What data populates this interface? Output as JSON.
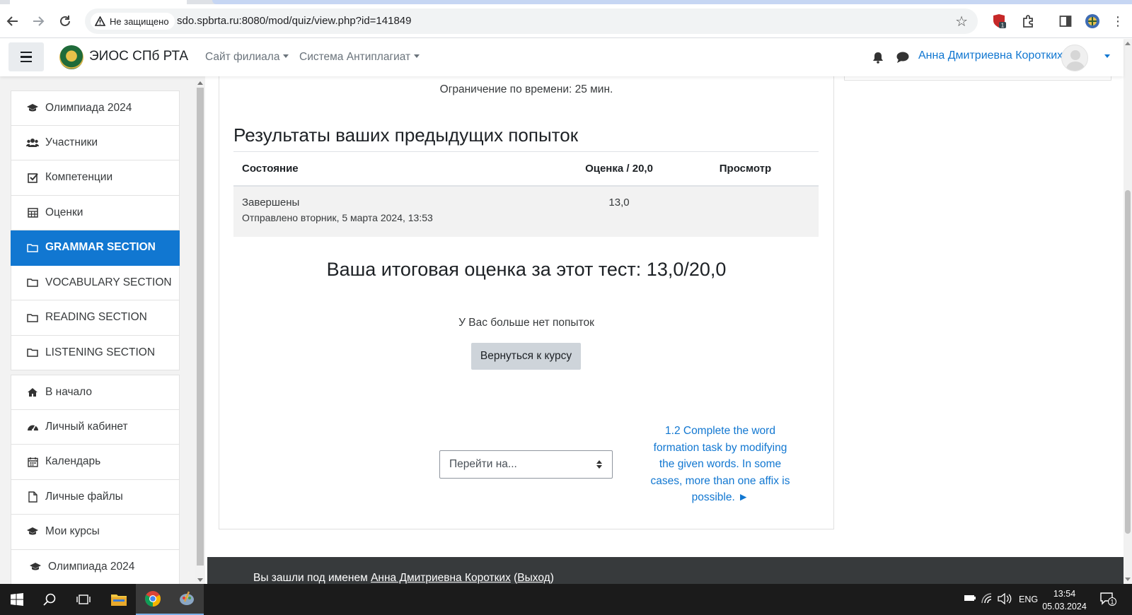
{
  "browser": {
    "security_label": "Не защищено",
    "url": "sdo.spbrta.ru:8080/mod/quiz/view.php?id=141849",
    "extension_badge": "1"
  },
  "navbar": {
    "brand": "ЭИОС СПб РТА",
    "menu": [
      {
        "label": "Сайт филиала"
      },
      {
        "label": "Система Антиплагиат"
      }
    ],
    "user_name": "Анна Дмитриевна Коротких"
  },
  "drawer": {
    "items": [
      {
        "label": "Олимпиада 2024",
        "icon": "graduation-cap-icon"
      },
      {
        "label": "Участники",
        "icon": "users-icon"
      },
      {
        "label": "Компетенции",
        "icon": "check-square-icon"
      },
      {
        "label": "Оценки",
        "icon": "table-icon"
      },
      {
        "label": "GRAMMAR SECTION",
        "icon": "folder-icon",
        "active": true
      },
      {
        "label": "VOCABULARY SECTION",
        "icon": "folder-icon"
      },
      {
        "label": "READING SECTION",
        "icon": "folder-icon"
      },
      {
        "label": "LISTENING SECTION",
        "icon": "folder-icon"
      }
    ],
    "items2": [
      {
        "label": "В начало",
        "icon": "home-icon"
      },
      {
        "label": "Личный кабинет",
        "icon": "dashboard-icon"
      },
      {
        "label": "Календарь",
        "icon": "calendar-icon"
      },
      {
        "label": "Личные файлы",
        "icon": "file-icon"
      },
      {
        "label": "Мои курсы",
        "icon": "graduation-cap-icon"
      },
      {
        "label": "Олимпиада 2024",
        "icon": "graduation-cap-icon"
      }
    ]
  },
  "quiz": {
    "time_limit": "Ограничение по времени: 25 мин.",
    "previous_title": "Результаты ваших предыдущих попыток",
    "table": {
      "headers": [
        "Состояние",
        "Оценка / 20,0",
        "Просмотр"
      ],
      "rows": [
        {
          "state": "Завершены",
          "submitted": "Отправлено вторник, 5 марта 2024, 13:53",
          "grade": "13,0",
          "review": ""
        }
      ]
    },
    "final_grade": "Ваша итоговая оценка за этот тест: 13,0/20,0",
    "no_more_attempts": "У Вас больше нет попыток",
    "back_button": "Вернуться к курсу",
    "jump_placeholder": "Перейти на...",
    "next_activity": "1.2 Complete the word formation task by modifying the given words. In some cases, more than one affix is possible. ►"
  },
  "footer": {
    "logged_in_prefix": "Вы зашли под именем ",
    "user_link": "Анна Дмитриевна Коротких",
    "paren_open": " (",
    "logout": "Выход",
    "paren_close": ")"
  },
  "taskbar": {
    "language": "ENG",
    "time": "13:54",
    "date": "05.03.2024",
    "notification_count": "1"
  },
  "colors": {
    "accent": "#1177d1",
    "footer_bg": "#373a3c",
    "button_secondary": "#ced4da"
  }
}
